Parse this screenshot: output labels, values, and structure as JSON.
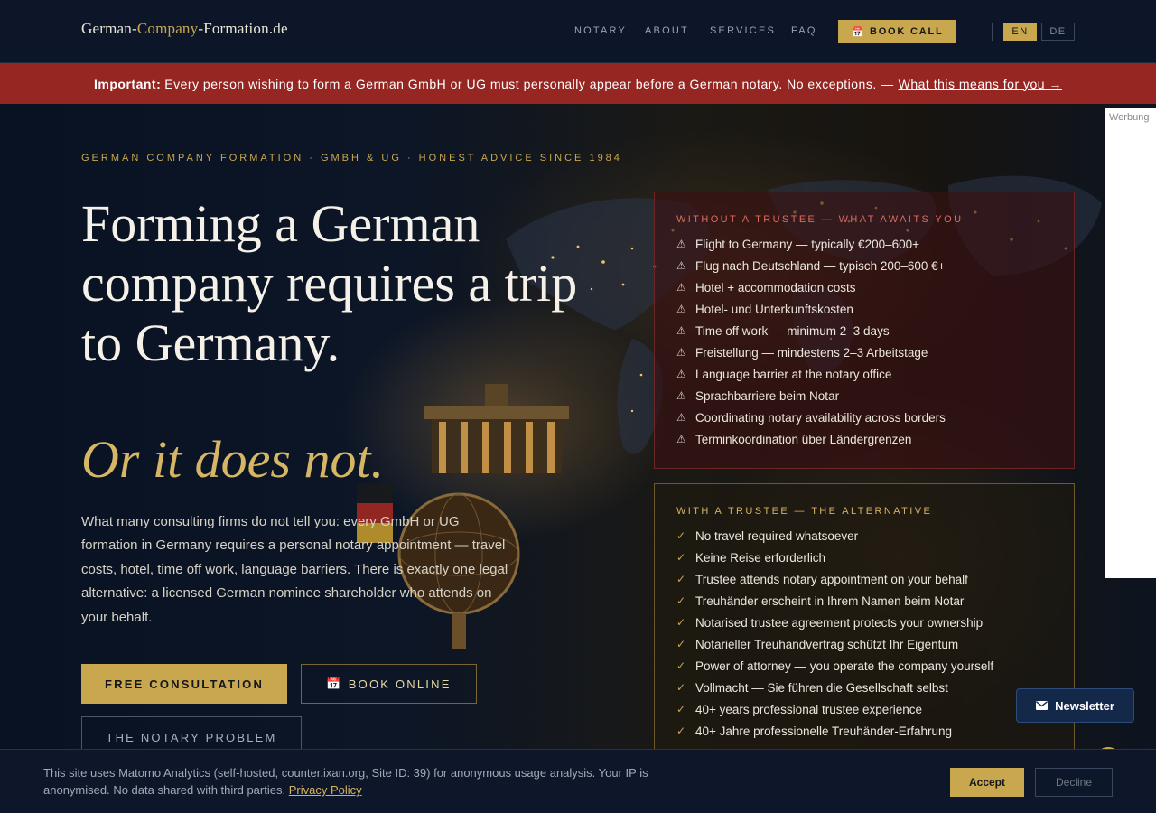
{
  "header": {
    "logo": {
      "part1": "German-",
      "part2": "Company",
      "part3": "-Formation.de"
    },
    "nav": [
      {
        "label": "NOTARY"
      },
      {
        "label": "ABOUT"
      },
      {
        "label": "SERVICES"
      },
      {
        "label": "FAQ"
      }
    ],
    "book_call_icon": "calendar-icon",
    "book_call_label": "BOOK CALL",
    "languages": [
      {
        "label": "EN",
        "active": true
      },
      {
        "label": "DE",
        "active": false
      }
    ]
  },
  "notice": {
    "strong": "Important:",
    "text": "Every person wishing to form a German GmbH or UG must personally appear before a German notary. No exceptions. —",
    "link": "What this means for you →"
  },
  "hero": {
    "eyebrow": "GERMAN COMPANY FORMATION · GMBH & UG · HONEST ADVICE SINCE 1984",
    "headline": "Forming a German company requires a trip to Germany.",
    "headline_italic": "Or it does not.",
    "lead": "What many consulting firms do not tell you: every GmbH or UG formation in Germany requires a personal notary appointment — travel costs, hotel, time off work, language barriers. There is exactly one legal alternative: a licensed German nominee shareholder who attends on your behalf.",
    "buttons": {
      "consultation": "FREE CONSULTATION",
      "book_online_icon": "calendar-icon",
      "book_online": "BOOK ONLINE",
      "notary_problem": "THE NOTARY PROBLEM"
    }
  },
  "cards": {
    "without": {
      "title": "WITHOUT A TRUSTEE — WHAT AWAITS YOU",
      "icon": "warning-icon",
      "marker": "⚠",
      "items": [
        "Flight to Germany — typically €200–600+",
        "Flug nach Deutschland — typisch 200–600 €+",
        "Hotel + accommodation costs",
        "Hotel- und Unterkunftskosten",
        "Time off work — minimum 2–3 days",
        "Freistellung — mindestens 2–3 Arbeitstage",
        "Language barrier at the notary office",
        "Sprachbarriere beim Notar",
        "Coordinating notary availability across borders",
        "Terminkoordination über Ländergrenzen"
      ]
    },
    "with": {
      "title": "WITH A TRUSTEE — THE ALTERNATIVE",
      "icon": "check-icon",
      "marker": "✓",
      "items": [
        "No travel required whatsoever",
        "Keine Reise erforderlich",
        "Trustee attends notary appointment on your behalf",
        "Treuhänder erscheint in Ihrem Namen beim Notar",
        "Notarised trustee agreement protects your ownership",
        "Notarieller Treuhandvertrag schützt Ihr Eigentum",
        "Power of attorney — you operate the company yourself",
        "Vollmacht — Sie führen die Gesellschaft selbst",
        "40+ years professional trustee experience",
        "40+ Jahre professionelle Treuhänder-Erfahrung"
      ]
    }
  },
  "ad": {
    "label": "Werbung"
  },
  "newsletter": {
    "icon": "envelope-icon",
    "label": "Newsletter"
  },
  "cookie": {
    "text": "This site uses Matomo Analytics (self-hosted, counter.ixan.org, Site ID: 39) for anonymous usage analysis. Your IP is anonymised. No data shared with third parties.",
    "link": "Privacy Policy",
    "accept": "Accept",
    "decline": "Decline"
  },
  "colors": {
    "gold": "#c9a74f",
    "navy": "#0a1323",
    "alert_red": "#952622",
    "cookie_bg": "#0e1729"
  }
}
